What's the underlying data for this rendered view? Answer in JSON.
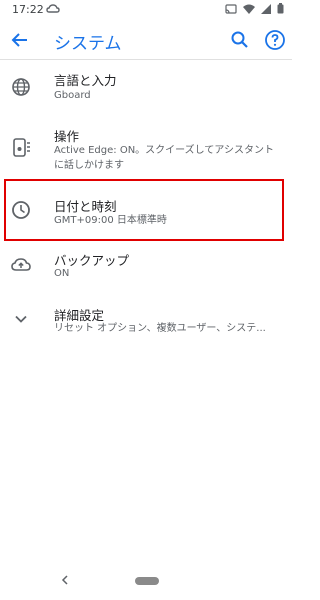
{
  "status_bar": {
    "time": "17:22"
  },
  "app_bar": {
    "title": "システム"
  },
  "items": [
    {
      "title": "言語と入力",
      "subtitle": "Gboard",
      "icon": "globe-icon"
    },
    {
      "title": "操作",
      "subtitle": "Active Edge: ON。スクイーズしてアシスタントに話しかけます",
      "icon": "gesture-phone-icon"
    },
    {
      "title": "日付と時刻",
      "subtitle": "GMT+09:00 日本標準時",
      "icon": "clock-icon"
    },
    {
      "title": "バックアップ",
      "subtitle": "ON",
      "icon": "cloud-upload-icon"
    },
    {
      "title": "詳細設定",
      "subtitle": "リセット オプション、複数ユーザー、システ...",
      "icon": "chevron-down-icon"
    }
  ],
  "colors": {
    "accent": "#1a73e8",
    "highlight": "#e00000"
  }
}
